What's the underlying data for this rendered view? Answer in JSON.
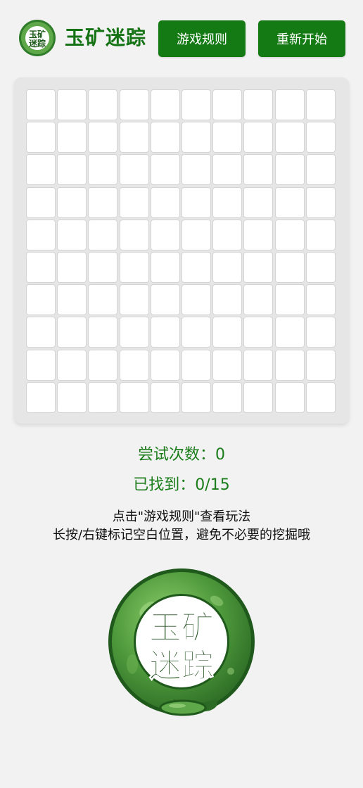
{
  "header": {
    "title": "玉矿迷踪",
    "logo_text_line1": "玉矿",
    "logo_text_line2": "迷踪",
    "rules_button": "游戏规则",
    "restart_button": "重新开始"
  },
  "board": {
    "rows": 10,
    "cols": 10,
    "revealed_cells": 0
  },
  "stats": {
    "attempts_text": "尝试次数：0",
    "attempts": 0,
    "found_text": "已找到：0/15",
    "found": 0,
    "total": 15
  },
  "hints": {
    "line1": "点击\"游戏规则\"查看玩法",
    "line2": "长按/右键标记空白位置，避免不必要的挖掘哦"
  },
  "emblem": {
    "line1": "玉矿",
    "line2": "迷踪"
  },
  "colors": {
    "accent": "#147a14",
    "text_green": "#1a7d1a",
    "background": "#f2f2f2",
    "board_bg": "#e6e6e6"
  }
}
